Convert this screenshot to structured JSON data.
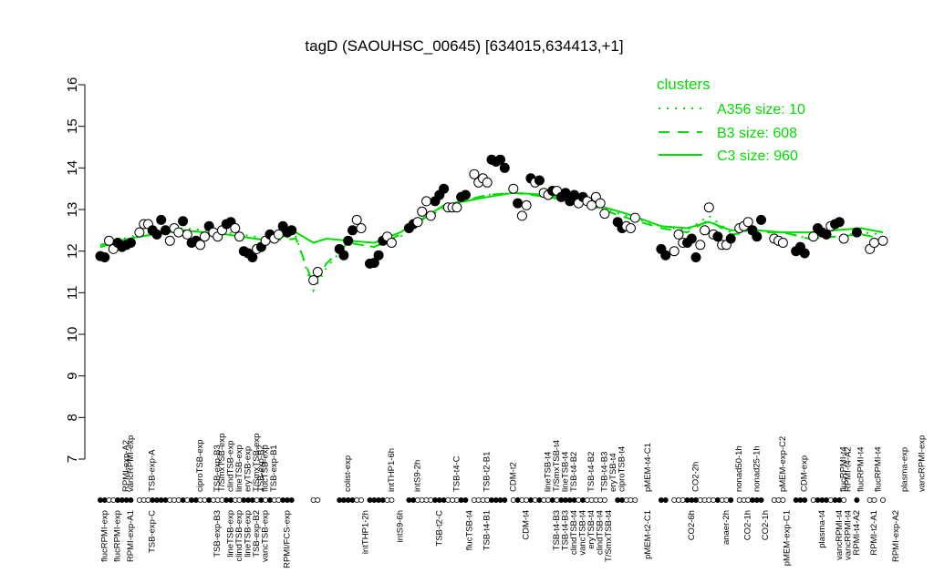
{
  "chart_data": {
    "type": "scatter",
    "title": "tagD (SAOUHSC_00645) [634015,634413,+1]",
    "xlabel": "",
    "ylabel": "",
    "ylim": [
      7,
      16
    ],
    "yticks": [
      "7",
      "8",
      "9",
      "10",
      "11",
      "12",
      "13",
      "14",
      "15",
      "16"
    ],
    "x_count": 181,
    "legend": {
      "title": "clusters",
      "placement": "top-right",
      "color": "#00dd00",
      "entries": [
        {
          "label": "A356 size: 10",
          "style": "dotted"
        },
        {
          "label": "B3 size: 608",
          "style": "dashed"
        },
        {
          "label": "C3 size: 960",
          "style": "solid"
        }
      ]
    },
    "top_labels": [
      {
        "x": 7,
        "text": "RPMI-exp-A2"
      },
      {
        "x": 8,
        "text": "vancRPMI-exp"
      },
      {
        "x": 13,
        "text": "TSB-exp-A"
      },
      {
        "x": 24,
        "text": "ciproTSB-exp"
      },
      {
        "x": 28,
        "text": "TSB-exp-B3"
      },
      {
        "x": 29,
        "text": "T/SmxTSB-exp"
      },
      {
        "x": 31,
        "text": "clindTSB-exp"
      },
      {
        "x": 33,
        "text": "lineTSB-exp"
      },
      {
        "x": 35,
        "text": "eryTSB-exp"
      },
      {
        "x": 37,
        "text": "T/SmxTSB-exp"
      },
      {
        "x": 38,
        "text": "TSB-exp-B2"
      },
      {
        "x": 39,
        "text": "flucTSB-exp"
      },
      {
        "x": 41,
        "text": "TSB-exp-B1"
      },
      {
        "x": 58,
        "text": "colist-exp"
      },
      {
        "x": 68,
        "text": "intTHP1-6h"
      },
      {
        "x": 74,
        "text": "intS9-2h"
      },
      {
        "x": 83,
        "text": "TSB-t4-C"
      },
      {
        "x": 90,
        "text": "TSB-t2-B1"
      },
      {
        "x": 96,
        "text": "CDM-t2"
      },
      {
        "x": 104,
        "text": "lineTSB-t4"
      },
      {
        "x": 106,
        "text": "T/SmxTSB-t4"
      },
      {
        "x": 108,
        "text": "lineTSB-t4"
      },
      {
        "x": 110,
        "text": "TSB-t4-B2"
      },
      {
        "x": 114,
        "text": "TSB-t4-B2"
      },
      {
        "x": 117,
        "text": "TSB-t4-B3"
      },
      {
        "x": 119,
        "text": "eryTSB-t4"
      },
      {
        "x": 121,
        "text": "ciproTSB-t4"
      },
      {
        "x": 127,
        "text": "pMEM-t4-C1"
      },
      {
        "x": 138,
        "text": "CO2-2h"
      },
      {
        "x": 148,
        "text": "nonad50-1h"
      },
      {
        "x": 152,
        "text": "nonad25-1h"
      },
      {
        "x": 158,
        "text": "pMEM-exp-C2"
      },
      {
        "x": 163,
        "text": "CDM-exp"
      },
      {
        "x": 172,
        "text": "flucRPMI-t4"
      },
      {
        "x": 173,
        "text": "RPMI-t4-A2"
      },
      {
        "x": 176,
        "text": "flucRPMI-t4"
      },
      {
        "x": 180,
        "text": "flucRPMI-t4"
      },
      {
        "x": 186,
        "text": "plasma-exp"
      },
      {
        "x": 190,
        "text": "vancRPMI-exp"
      }
    ],
    "bottom_labels": [
      {
        "x": 2,
        "text": "flucRPMI-exp"
      },
      {
        "x": 5,
        "text": "flucRPMI-exp"
      },
      {
        "x": 8,
        "text": "RPMI-exp-A1"
      },
      {
        "x": 13,
        "text": "TSB-exp-C"
      },
      {
        "x": 28,
        "text": "TSB-exp-B3"
      },
      {
        "x": 31,
        "text": "lineTSB-exp"
      },
      {
        "x": 33,
        "text": "clindTSB-exp"
      },
      {
        "x": 35,
        "text": "lineTSB-exp"
      },
      {
        "x": 37,
        "text": "TSB-exp-B2"
      },
      {
        "x": 39,
        "text": "vancTSB-exp"
      },
      {
        "x": 44,
        "text": "RPMI/FCS-exp"
      },
      {
        "x": 62,
        "text": "intTHP1-2h"
      },
      {
        "x": 70,
        "text": "intS9-6h"
      },
      {
        "x": 79,
        "text": "TSB-t2-C"
      },
      {
        "x": 86,
        "text": "flucTSB-t4"
      },
      {
        "x": 90,
        "text": "TSB-t4-B1"
      },
      {
        "x": 99,
        "text": "CDM-t4"
      },
      {
        "x": 106,
        "text": "TSB-t4-B3"
      },
      {
        "x": 108,
        "text": "TSB-t4-B3"
      },
      {
        "x": 110,
        "text": "clindTSB-t4"
      },
      {
        "x": 112,
        "text": "vancTSB-t4"
      },
      {
        "x": 114,
        "text": "eryTSB-t4"
      },
      {
        "x": 116,
        "text": "clindTSB-t4"
      },
      {
        "x": 118,
        "text": "T/SmxTSB-t4"
      },
      {
        "x": 127,
        "text": "pMEM-t2-C1"
      },
      {
        "x": 137,
        "text": "CO2-6h"
      },
      {
        "x": 145,
        "text": "anaer-2h"
      },
      {
        "x": 150,
        "text": "CO2-1h"
      },
      {
        "x": 154,
        "text": "CO2-1h"
      },
      {
        "x": 159,
        "text": "pMEM-exp-C1"
      },
      {
        "x": 167,
        "text": "plasma-t4"
      },
      {
        "x": 171,
        "text": "vancRPMI-t4"
      },
      {
        "x": 173,
        "text": "vancRPMI-t4"
      },
      {
        "x": 175,
        "text": "RPMI-t4-A2"
      },
      {
        "x": 179,
        "text": "RPMI-t2-A1"
      },
      {
        "x": 184,
        "text": "RPMI-exp-A2"
      }
    ],
    "points": [
      {
        "x": 1,
        "y": 11.88,
        "filled": true
      },
      {
        "x": 2,
        "y": 11.85,
        "filled": true
      },
      {
        "x": 3,
        "y": 12.25,
        "filled": false
      },
      {
        "x": 4,
        "y": 12.05,
        "filled": false
      },
      {
        "x": 5,
        "y": 12.2,
        "filled": true
      },
      {
        "x": 6,
        "y": 12.1,
        "filled": true
      },
      {
        "x": 7,
        "y": 12.15,
        "filled": true
      },
      {
        "x": 8,
        "y": 12.2,
        "filled": true
      },
      {
        "x": 10,
        "y": 12.45,
        "filled": false
      },
      {
        "x": 11,
        "y": 12.65,
        "filled": false
      },
      {
        "x": 12,
        "y": 12.65,
        "filled": false
      },
      {
        "x": 13,
        "y": 12.5,
        "filled": true
      },
      {
        "x": 14,
        "y": 12.4,
        "filled": true
      },
      {
        "x": 15,
        "y": 12.75,
        "filled": true
      },
      {
        "x": 16,
        "y": 12.5,
        "filled": true
      },
      {
        "x": 17,
        "y": 12.25,
        "filled": false
      },
      {
        "x": 18,
        "y": 12.55,
        "filled": false
      },
      {
        "x": 19,
        "y": 12.45,
        "filled": false
      },
      {
        "x": 20,
        "y": 12.72,
        "filled": true
      },
      {
        "x": 21,
        "y": 12.4,
        "filled": false
      },
      {
        "x": 22,
        "y": 12.2,
        "filled": true
      },
      {
        "x": 23,
        "y": 12.25,
        "filled": true
      },
      {
        "x": 24,
        "y": 12.15,
        "filled": false
      },
      {
        "x": 25,
        "y": 12.35,
        "filled": false
      },
      {
        "x": 26,
        "y": 12.6,
        "filled": true
      },
      {
        "x": 27,
        "y": 12.45,
        "filled": false
      },
      {
        "x": 28,
        "y": 12.35,
        "filled": false
      },
      {
        "x": 29,
        "y": 12.5,
        "filled": false
      },
      {
        "x": 30,
        "y": 12.65,
        "filled": true
      },
      {
        "x": 31,
        "y": 12.7,
        "filled": true
      },
      {
        "x": 32,
        "y": 12.55,
        "filled": false
      },
      {
        "x": 33,
        "y": 12.35,
        "filled": false
      },
      {
        "x": 34,
        "y": 12.0,
        "filled": true
      },
      {
        "x": 35,
        "y": 11.95,
        "filled": true
      },
      {
        "x": 36,
        "y": 11.85,
        "filled": true
      },
      {
        "x": 37,
        "y": 12.05,
        "filled": false
      },
      {
        "x": 38,
        "y": 12.1,
        "filled": true
      },
      {
        "x": 39,
        "y": 12.25,
        "filled": false
      },
      {
        "x": 40,
        "y": 12.4,
        "filled": true
      },
      {
        "x": 41,
        "y": 12.3,
        "filled": false
      },
      {
        "x": 42,
        "y": 12.4,
        "filled": false
      },
      {
        "x": 43,
        "y": 12.6,
        "filled": true
      },
      {
        "x": 44,
        "y": 12.45,
        "filled": true
      },
      {
        "x": 45,
        "y": 12.5,
        "filled": true
      },
      {
        "x": 50,
        "y": 11.3,
        "filled": false
      },
      {
        "x": 51,
        "y": 11.5,
        "filled": false
      },
      {
        "x": 56,
        "y": 12.05,
        "filled": true
      },
      {
        "x": 57,
        "y": 11.9,
        "filled": true
      },
      {
        "x": 58,
        "y": 12.25,
        "filled": true
      },
      {
        "x": 59,
        "y": 12.5,
        "filled": true
      },
      {
        "x": 60,
        "y": 12.75,
        "filled": false
      },
      {
        "x": 61,
        "y": 12.55,
        "filled": false
      },
      {
        "x": 63,
        "y": 11.7,
        "filled": true
      },
      {
        "x": 64,
        "y": 11.72,
        "filled": true
      },
      {
        "x": 65,
        "y": 11.9,
        "filled": true
      },
      {
        "x": 66,
        "y": 12.25,
        "filled": true
      },
      {
        "x": 67,
        "y": 12.35,
        "filled": false
      },
      {
        "x": 68,
        "y": 12.2,
        "filled": false
      },
      {
        "x": 72,
        "y": 12.55,
        "filled": true
      },
      {
        "x": 73,
        "y": 12.65,
        "filled": true
      },
      {
        "x": 74,
        "y": 12.7,
        "filled": false
      },
      {
        "x": 75,
        "y": 12.95,
        "filled": false
      },
      {
        "x": 76,
        "y": 13.2,
        "filled": false
      },
      {
        "x": 77,
        "y": 12.85,
        "filled": false
      },
      {
        "x": 78,
        "y": 13.2,
        "filled": true
      },
      {
        "x": 79,
        "y": 13.35,
        "filled": true
      },
      {
        "x": 80,
        "y": 13.5,
        "filled": true
      },
      {
        "x": 81,
        "y": 13.05,
        "filled": false
      },
      {
        "x": 82,
        "y": 13.05,
        "filled": false
      },
      {
        "x": 83,
        "y": 13.05,
        "filled": false
      },
      {
        "x": 84,
        "y": 13.3,
        "filled": true
      },
      {
        "x": 85,
        "y": 13.35,
        "filled": true
      },
      {
        "x": 87,
        "y": 13.85,
        "filled": false
      },
      {
        "x": 88,
        "y": 13.65,
        "filled": false
      },
      {
        "x": 89,
        "y": 13.75,
        "filled": false
      },
      {
        "x": 90,
        "y": 13.65,
        "filled": false
      },
      {
        "x": 91,
        "y": 14.2,
        "filled": true
      },
      {
        "x": 92,
        "y": 14.15,
        "filled": true
      },
      {
        "x": 93,
        "y": 14.2,
        "filled": true
      },
      {
        "x": 94,
        "y": 14.0,
        "filled": true
      },
      {
        "x": 96,
        "y": 13.5,
        "filled": false
      },
      {
        "x": 97,
        "y": 13.15,
        "filled": true
      },
      {
        "x": 98,
        "y": 12.85,
        "filled": false
      },
      {
        "x": 99,
        "y": 13.1,
        "filled": false
      },
      {
        "x": 100,
        "y": 13.75,
        "filled": true
      },
      {
        "x": 101,
        "y": 13.65,
        "filled": false
      },
      {
        "x": 102,
        "y": 13.7,
        "filled": true
      },
      {
        "x": 103,
        "y": 13.4,
        "filled": false
      },
      {
        "x": 104,
        "y": 13.35,
        "filled": false
      },
      {
        "x": 105,
        "y": 13.45,
        "filled": true
      },
      {
        "x": 106,
        "y": 13.45,
        "filled": false
      },
      {
        "x": 107,
        "y": 13.3,
        "filled": true
      },
      {
        "x": 108,
        "y": 13.4,
        "filled": true
      },
      {
        "x": 109,
        "y": 13.2,
        "filled": true
      },
      {
        "x": 110,
        "y": 13.35,
        "filled": true
      },
      {
        "x": 111,
        "y": 13.15,
        "filled": false
      },
      {
        "x": 112,
        "y": 13.3,
        "filled": true
      },
      {
        "x": 113,
        "y": 13.2,
        "filled": false
      },
      {
        "x": 114,
        "y": 13.1,
        "filled": false
      },
      {
        "x": 115,
        "y": 13.3,
        "filled": false
      },
      {
        "x": 116,
        "y": 13.15,
        "filled": false
      },
      {
        "x": 117,
        "y": 12.9,
        "filled": false
      },
      {
        "x": 120,
        "y": 12.7,
        "filled": true
      },
      {
        "x": 121,
        "y": 12.55,
        "filled": true
      },
      {
        "x": 122,
        "y": 12.6,
        "filled": false
      },
      {
        "x": 123,
        "y": 12.55,
        "filled": false
      },
      {
        "x": 124,
        "y": 12.8,
        "filled": false
      },
      {
        "x": 130,
        "y": 12.05,
        "filled": true
      },
      {
        "x": 131,
        "y": 11.9,
        "filled": true
      },
      {
        "x": 133,
        "y": 12.0,
        "filled": false
      },
      {
        "x": 134,
        "y": 12.4,
        "filled": false
      },
      {
        "x": 135,
        "y": 12.2,
        "filled": false
      },
      {
        "x": 136,
        "y": 12.2,
        "filled": true
      },
      {
        "x": 137,
        "y": 12.3,
        "filled": true
      },
      {
        "x": 138,
        "y": 11.85,
        "filled": true
      },
      {
        "x": 139,
        "y": 12.15,
        "filled": false
      },
      {
        "x": 140,
        "y": 12.5,
        "filled": false
      },
      {
        "x": 141,
        "y": 13.05,
        "filled": false
      },
      {
        "x": 142,
        "y": 12.4,
        "filled": false
      },
      {
        "x": 143,
        "y": 12.35,
        "filled": true
      },
      {
        "x": 144,
        "y": 12.15,
        "filled": false
      },
      {
        "x": 145,
        "y": 12.15,
        "filled": false
      },
      {
        "x": 146,
        "y": 12.3,
        "filled": true
      },
      {
        "x": 148,
        "y": 12.55,
        "filled": false
      },
      {
        "x": 149,
        "y": 12.6,
        "filled": false
      },
      {
        "x": 150,
        "y": 12.7,
        "filled": false
      },
      {
        "x": 151,
        "y": 12.5,
        "filled": true
      },
      {
        "x": 152,
        "y": 12.35,
        "filled": true
      },
      {
        "x": 153,
        "y": 12.75,
        "filled": true
      },
      {
        "x": 156,
        "y": 12.3,
        "filled": false
      },
      {
        "x": 157,
        "y": 12.25,
        "filled": false
      },
      {
        "x": 158,
        "y": 12.2,
        "filled": false
      },
      {
        "x": 161,
        "y": 12.0,
        "filled": true
      },
      {
        "x": 162,
        "y": 12.1,
        "filled": true
      },
      {
        "x": 163,
        "y": 11.95,
        "filled": true
      },
      {
        "x": 165,
        "y": 12.35,
        "filled": false
      },
      {
        "x": 166,
        "y": 12.55,
        "filled": true
      },
      {
        "x": 167,
        "y": 12.45,
        "filled": true
      },
      {
        "x": 168,
        "y": 12.4,
        "filled": true
      },
      {
        "x": 169,
        "y": 12.6,
        "filled": false
      },
      {
        "x": 170,
        "y": 12.65,
        "filled": true
      },
      {
        "x": 171,
        "y": 12.7,
        "filled": true
      },
      {
        "x": 172,
        "y": 12.3,
        "filled": false
      },
      {
        "x": 175,
        "y": 12.45,
        "filled": true
      },
      {
        "x": 178,
        "y": 12.05,
        "filled": false
      },
      {
        "x": 179,
        "y": 12.2,
        "filled": false
      },
      {
        "x": 181,
        "y": 12.25,
        "filled": false
      }
    ],
    "series": [
      {
        "name": "A356 size: 10",
        "style": "dotted",
        "x": [
          1,
          10,
          20,
          30,
          40,
          46,
          50,
          53,
          58,
          64,
          70,
          80,
          90,
          96,
          104,
          112,
          122,
          130,
          136,
          141,
          146,
          152,
          158,
          164,
          170,
          176,
          181
        ],
        "y": [
          12.15,
          12.4,
          12.55,
          12.45,
          12.3,
          12.35,
          11.05,
          11.6,
          12.2,
          12.1,
          12.35,
          13.05,
          13.35,
          13.4,
          13.35,
          13.15,
          12.85,
          12.6,
          12.5,
          12.85,
          12.45,
          12.5,
          12.45,
          12.3,
          12.35,
          12.45,
          12.4
        ]
      },
      {
        "name": "B3 size: 608",
        "style": "dashed",
        "x": [
          1,
          10,
          20,
          30,
          40,
          46,
          50,
          53,
          58,
          64,
          70,
          80,
          90,
          96,
          104,
          112,
          122,
          130,
          136,
          141,
          146,
          152,
          158,
          164,
          170,
          176,
          181
        ],
        "y": [
          12.1,
          12.35,
          12.5,
          12.4,
          12.25,
          12.3,
          11.2,
          11.7,
          12.2,
          12.1,
          12.4,
          13.1,
          13.35,
          13.4,
          13.3,
          13.15,
          12.8,
          12.55,
          12.45,
          12.75,
          12.4,
          12.45,
          12.45,
          12.3,
          12.35,
          12.4,
          12.3
        ]
      },
      {
        "name": "C3 size: 960",
        "style": "solid",
        "x": [
          1,
          10,
          20,
          30,
          40,
          46,
          50,
          53,
          58,
          64,
          70,
          80,
          90,
          96,
          104,
          112,
          122,
          130,
          136,
          141,
          146,
          152,
          158,
          164,
          170,
          176,
          181
        ],
        "y": [
          12.15,
          12.35,
          12.5,
          12.4,
          12.25,
          12.45,
          12.2,
          12.3,
          12.25,
          12.2,
          12.45,
          13.1,
          13.3,
          13.4,
          13.35,
          13.2,
          12.9,
          12.6,
          12.55,
          12.7,
          12.5,
          12.5,
          12.45,
          12.45,
          12.5,
          12.55,
          12.45
        ]
      }
    ]
  }
}
